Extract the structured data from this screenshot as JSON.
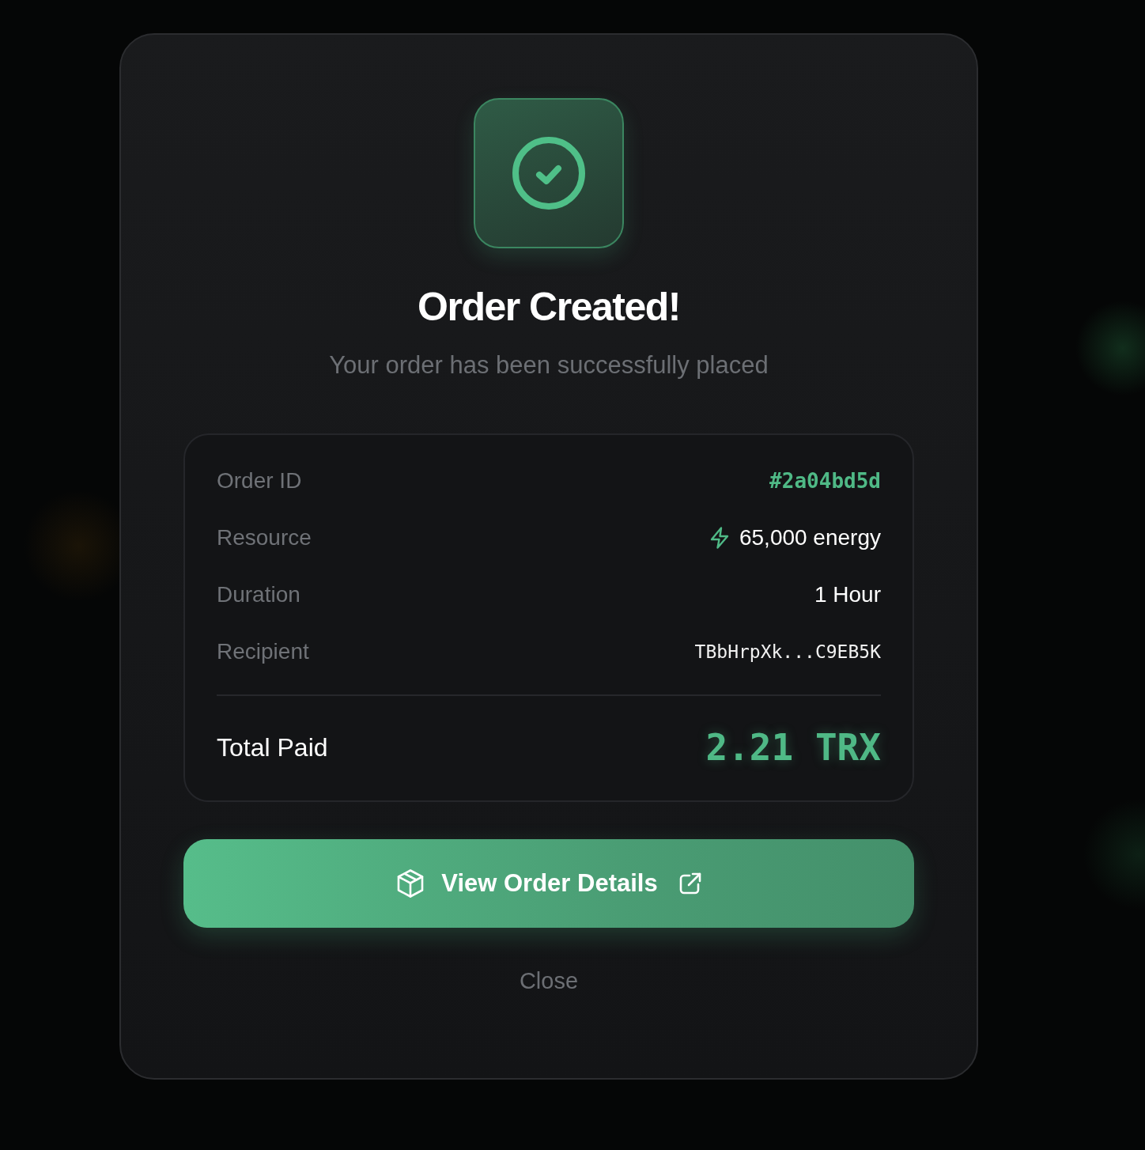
{
  "dialog": {
    "title": "Order Created!",
    "subtitle": "Your order has been successfully placed"
  },
  "details": {
    "rows": [
      {
        "label": "Order ID",
        "value": "#2a04bd5d",
        "kind": "id"
      },
      {
        "label": "Resource",
        "value": "65,000 energy",
        "kind": "energy"
      },
      {
        "label": "Duration",
        "value": "1 Hour",
        "kind": "text"
      },
      {
        "label": "Recipient",
        "value": "TBbHrpXk...C9EB5K",
        "kind": "address"
      }
    ],
    "total": {
      "label": "Total Paid",
      "value": "2.21 TRX"
    }
  },
  "actions": {
    "primary": "View Order Details",
    "secondary": "Close"
  }
}
